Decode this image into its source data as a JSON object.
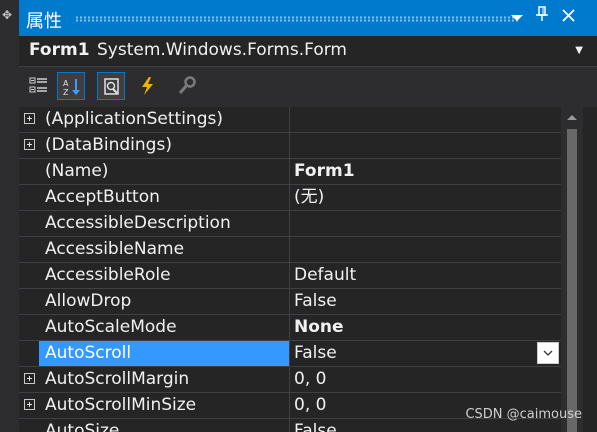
{
  "window": {
    "title": "属性",
    "buttons": {
      "dropdown_icon": "dropdown-arrow-icon",
      "pin_icon": "pin-icon",
      "close_icon": "close-icon"
    }
  },
  "object_selector": {
    "name": "Form1",
    "type": "System.Windows.Forms.Form"
  },
  "toolbar": {
    "tools": [
      {
        "icon": "categorized-icon",
        "active": false
      },
      {
        "icon": "alphabetical-icon",
        "active": true
      },
      {
        "icon": "properties-icon",
        "active": true
      },
      {
        "icon": "events-lightning-icon",
        "active": false
      },
      {
        "icon": "property-pages-wrench-icon",
        "active": false
      }
    ]
  },
  "properties": [
    {
      "name": "(ApplicationSettings)",
      "value": "",
      "expandable": true
    },
    {
      "name": "(DataBindings)",
      "value": "",
      "expandable": true
    },
    {
      "name": "(Name)",
      "value": "Form1",
      "bold": true
    },
    {
      "name": "AcceptButton",
      "value": "(无)"
    },
    {
      "name": "AccessibleDescription",
      "value": ""
    },
    {
      "name": "AccessibleName",
      "value": ""
    },
    {
      "name": "AccessibleRole",
      "value": "Default"
    },
    {
      "name": "AllowDrop",
      "value": "False"
    },
    {
      "name": "AutoScaleMode",
      "value": "None",
      "bold": true
    },
    {
      "name": "AutoScroll",
      "value": "False",
      "selected": true
    },
    {
      "name": "AutoScrollMargin",
      "value": "0, 0",
      "expandable": true
    },
    {
      "name": "AutoScrollMinSize",
      "value": "0, 0",
      "expandable": true
    },
    {
      "name": "AutoSize",
      "value": "False"
    }
  ],
  "watermark": "CSDN @caimouse",
  "colors": {
    "accent": "#007acc",
    "selection": "#3399ff",
    "background": "#252526"
  }
}
